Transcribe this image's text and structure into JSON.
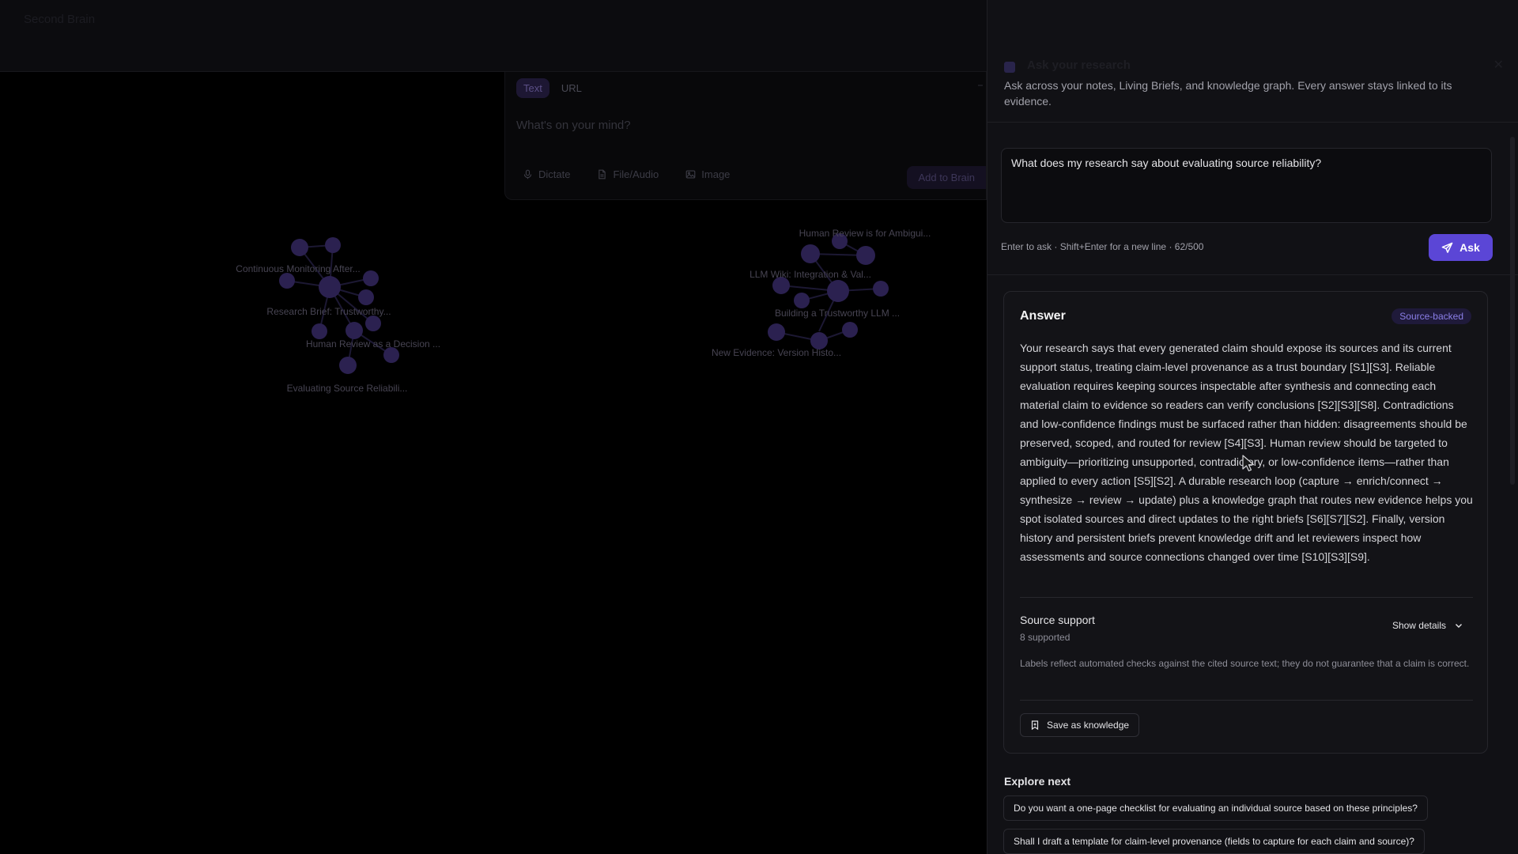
{
  "topbar": {
    "brand": "Second Brain"
  },
  "capture": {
    "tabs": [
      {
        "label": "Text",
        "active": true
      },
      {
        "label": "URL",
        "active": false
      }
    ],
    "placeholder": "What's on your mind?",
    "tools": [
      {
        "label": "Dictate",
        "icon": "microphone-icon"
      },
      {
        "label": "File/Audio",
        "icon": "file-icon"
      },
      {
        "label": "Image",
        "icon": "image-icon"
      }
    ],
    "add_label": "Add to Brain"
  },
  "graph": {
    "node_color": "#2b2150",
    "edge_color": "#1c1833",
    "label_color": "#474452",
    "labels": [
      "Continuous Monitoring After...",
      "Research Brief: Trustworthy...",
      "Human Review as a Decision ...",
      "Evaluating Source Reliabili...",
      "Human Review is for Ambigui...",
      "LLM Wiki: Integration & Val...",
      "Building a Trustworthy LLM ...",
      "New Evidence: Version Histo..."
    ]
  },
  "panel": {
    "title": "Ask your research",
    "subtitle": "Ask across your notes, Living Briefs, and knowledge graph. Every answer stays linked to its evidence.",
    "question": "What does my research say about evaluating source reliability?",
    "hint": "Enter to ask · Shift+Enter for a new line · 62/500",
    "ask_label": "Ask",
    "accent": "#5b46d6"
  },
  "answer": {
    "title": "Answer",
    "badge": "Source-backed",
    "body": "Your research says that every generated claim should expose its sources and its current support status, treating claim-level provenance as a trust boundary [S1][S3]. Reliable evaluation requires keeping sources inspectable after synthesis and connecting each material claim to evidence so readers can verify conclusions [S2][S3][S8]. Contradictions and low-confidence findings must be surfaced rather than hidden: disagreements should be preserved, scoped, and routed for review [S4][S3]. Human review should be targeted to ambiguity—prioritizing unsupported, contradictory, or low-confidence items—rather than applied to every action [S5][S2]. A durable research loop (capture → enrich/connect → synthesize → review → update) plus a knowledge graph that routes new evidence helps you spot isolated sources and direct updates to the right briefs [S6][S7][S2]. Finally, version history and persistent briefs prevent knowledge drift and let reviewers inspect how assessments and source connections changed over time [S10][S3][S9].",
    "source_support": {
      "title": "Source support",
      "count": "8 supported",
      "toggle": "Show details",
      "note": "Labels reflect automated checks against the cited source text; they do not guarantee that a claim is correct."
    },
    "save_label": "Save as knowledge"
  },
  "explore": {
    "title": "Explore next",
    "items": [
      "Do you want a one-page checklist for evaluating an individual source based on these principles?",
      "Shall I draft a template for claim-level provenance (fields to capture for each claim and source)?"
    ]
  }
}
